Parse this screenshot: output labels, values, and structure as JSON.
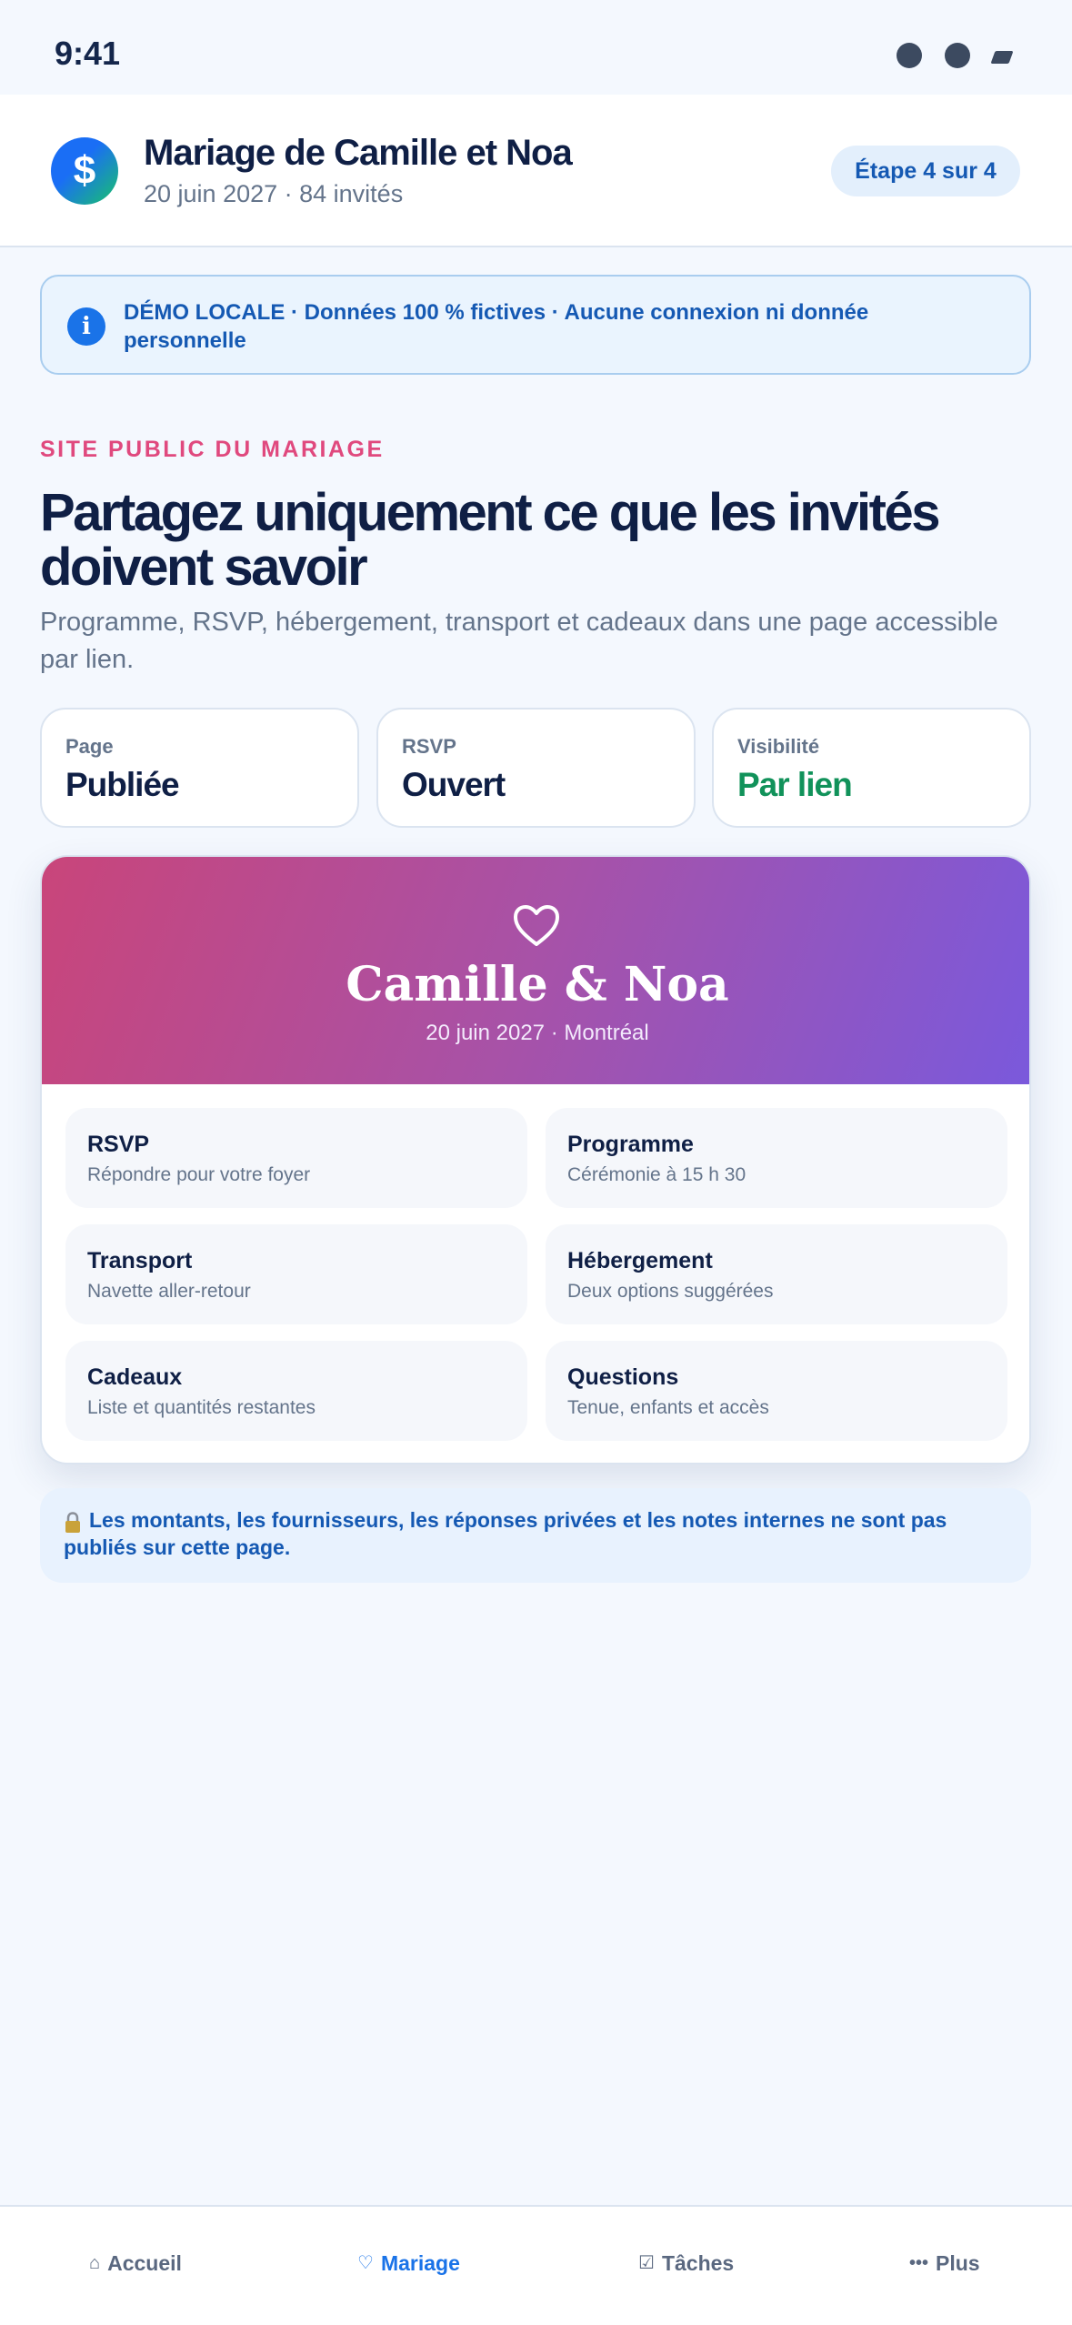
{
  "status_bar": {
    "time": "9:41"
  },
  "header": {
    "logo_symbol": "$",
    "title": "Mariage de Camille et Noa",
    "subtitle": "20 juin 2027 · 84 invités",
    "step_label": "Étape 4 sur 4"
  },
  "demo_banner": {
    "icon": "i",
    "text": "DÉMO LOCALE · Données 100 % fictives · Aucune connexion ni donnée personnelle"
  },
  "hero": {
    "eyebrow": "SITE PUBLIC DU MARIAGE",
    "title": "Partagez uniquement ce que les invités doivent savoir",
    "subtitle": "Programme, RSVP, hébergement, transport et cadeaux dans une page accessible par lien."
  },
  "stats": [
    {
      "label": "Page",
      "value": "Publiée"
    },
    {
      "label": "RSVP",
      "value": "Ouvert"
    },
    {
      "label": "Visibilité",
      "value": "Par lien"
    }
  ],
  "preview": {
    "couple": "Camille & Noa",
    "date_place": "20 juin 2027 · Montréal",
    "tiles": [
      {
        "title": "RSVP",
        "subtitle": "Répondre pour votre foyer"
      },
      {
        "title": "Programme",
        "subtitle": "Cérémonie à 15 h 30"
      },
      {
        "title": "Transport",
        "subtitle": "Navette aller-retour"
      },
      {
        "title": "Hébergement",
        "subtitle": "Deux options suggérées"
      },
      {
        "title": "Cadeaux",
        "subtitle": "Liste et quantités restantes"
      },
      {
        "title": "Questions",
        "subtitle": "Tenue, enfants et accès"
      }
    ]
  },
  "privacy_note": "Les montants, les fournisseurs, les réponses privées et les notes internes ne sont pas publiés sur cette page.",
  "tab_bar": {
    "items": [
      {
        "icon": "home-icon",
        "glyph": "⌂",
        "label": "Accueil"
      },
      {
        "icon": "heart-icon",
        "glyph": "♡",
        "label": "Mariage"
      },
      {
        "icon": "checkbox-icon",
        "glyph": "☑",
        "label": "Tâches"
      },
      {
        "icon": "more-icon",
        "glyph": "•••",
        "label": "Plus"
      }
    ],
    "active_index": 1
  },
  "colors": {
    "accent": "#1a73e8",
    "eyebrow": "#e0497e",
    "success": "#11925a",
    "background": "#f4f8fe"
  }
}
